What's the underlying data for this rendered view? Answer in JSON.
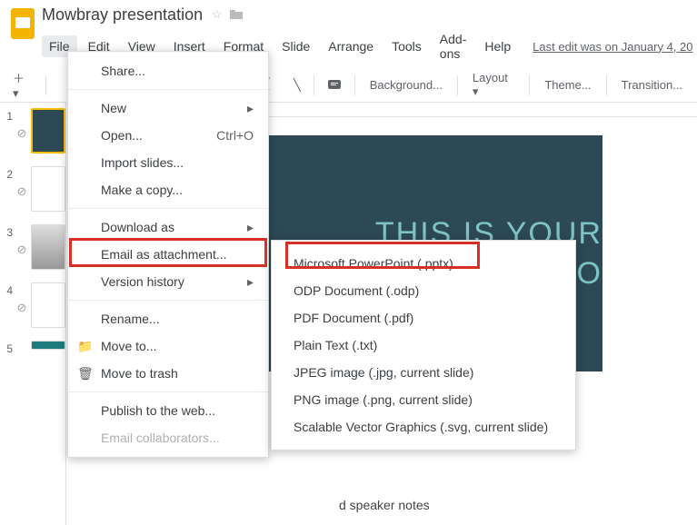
{
  "doc": {
    "title": "Mowbray presentation"
  },
  "menubar": {
    "file": "File",
    "edit": "Edit",
    "view": "View",
    "insert": "Insert",
    "format": "Format",
    "slide": "Slide",
    "arrange": "Arrange",
    "tools": "Tools",
    "addons": "Add-ons",
    "help": "Help",
    "last_edit": "Last edit was on January 4, 20"
  },
  "toolbar": {
    "background": "Background...",
    "layout": "Layout",
    "theme": "Theme...",
    "transition": "Transition..."
  },
  "thumbs": {
    "n1": "1",
    "n2": "2",
    "n3": "3",
    "n4": "4",
    "n5": "5"
  },
  "slide": {
    "line1": "THIS IS YOUR",
    "line2": "ENTATIO"
  },
  "speaker_notes_hint": "d speaker notes",
  "file_menu": {
    "share": "Share...",
    "new": "New",
    "open": "Open...",
    "open_shortcut": "Ctrl+O",
    "import": "Import slides...",
    "copy": "Make a copy...",
    "download": "Download as",
    "email_attach": "Email as attachment...",
    "version": "Version history",
    "rename": "Rename...",
    "moveto": "Move to...",
    "trash": "Move to trash",
    "publish": "Publish to the web...",
    "email_collab": "Email collaborators..."
  },
  "download_menu": {
    "pptx": "Microsoft PowerPoint (.pptx)",
    "odp": "ODP Document (.odp)",
    "pdf": "PDF Document (.pdf)",
    "txt": "Plain Text (.txt)",
    "jpg": "JPEG image (.jpg, current slide)",
    "png": "PNG image (.png, current slide)",
    "svg": "Scalable Vector Graphics (.svg, current slide)"
  }
}
